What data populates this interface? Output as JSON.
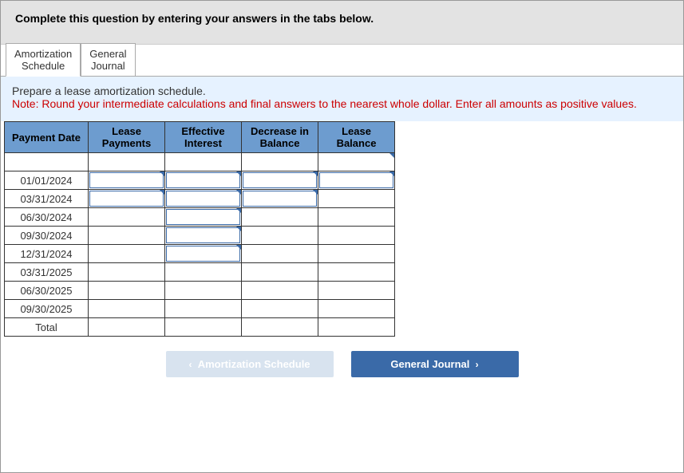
{
  "header": {
    "instruction": "Complete this question by entering your answers in the tabs below."
  },
  "tabs": [
    {
      "line1": "Amortization",
      "line2": "Schedule",
      "active": true
    },
    {
      "line1": "General",
      "line2": "Journal",
      "active": false
    }
  ],
  "note": {
    "line1": "Prepare a lease amortization schedule.",
    "line2": "Note: Round your intermediate calculations and final answers to the nearest whole dollar. Enter all amounts as positive values."
  },
  "table": {
    "headers": [
      "Payment Date",
      "Lease Payments",
      "Effective Interest",
      "Decrease in Balance",
      "Lease Balance"
    ],
    "rows": [
      {
        "date": "",
        "vals": [
          "",
          "",
          "",
          ""
        ],
        "active": [
          false,
          false,
          false,
          false
        ],
        "tick": [
          false,
          false,
          false,
          true
        ]
      },
      {
        "date": "01/01/2024",
        "vals": [
          "",
          "",
          "",
          ""
        ],
        "active": [
          true,
          true,
          true,
          true
        ],
        "tick": [
          true,
          true,
          true,
          true
        ]
      },
      {
        "date": "03/31/2024",
        "vals": [
          "",
          "",
          "",
          ""
        ],
        "active": [
          true,
          true,
          true,
          false
        ],
        "tick": [
          true,
          true,
          true,
          false
        ]
      },
      {
        "date": "06/30/2024",
        "vals": [
          "",
          "",
          "",
          ""
        ],
        "active": [
          false,
          true,
          false,
          false
        ],
        "tick": [
          false,
          true,
          false,
          false
        ]
      },
      {
        "date": "09/30/2024",
        "vals": [
          "",
          "",
          "",
          ""
        ],
        "active": [
          false,
          true,
          false,
          false
        ],
        "tick": [
          false,
          true,
          false,
          false
        ]
      },
      {
        "date": "12/31/2024",
        "vals": [
          "",
          "",
          "",
          ""
        ],
        "active": [
          false,
          true,
          false,
          false
        ],
        "tick": [
          false,
          true,
          false,
          false
        ]
      },
      {
        "date": "03/31/2025",
        "vals": [
          "",
          "",
          "",
          ""
        ],
        "active": [
          false,
          false,
          false,
          false
        ],
        "tick": [
          false,
          false,
          false,
          false
        ]
      },
      {
        "date": "06/30/2025",
        "vals": [
          "",
          "",
          "",
          ""
        ],
        "active": [
          false,
          false,
          false,
          false
        ],
        "tick": [
          false,
          false,
          false,
          false
        ]
      },
      {
        "date": "09/30/2025",
        "vals": [
          "",
          "",
          "",
          ""
        ],
        "active": [
          false,
          false,
          false,
          false
        ],
        "tick": [
          false,
          false,
          false,
          false
        ]
      },
      {
        "date": "Total",
        "vals": [
          "",
          "",
          "",
          ""
        ],
        "active": [
          false,
          false,
          false,
          false
        ],
        "tick": [
          false,
          false,
          false,
          false
        ]
      }
    ]
  },
  "nav": {
    "prev": {
      "label": "Amortization Schedule",
      "chev": "‹"
    },
    "next": {
      "label": "General Journal",
      "chev": "›"
    }
  }
}
